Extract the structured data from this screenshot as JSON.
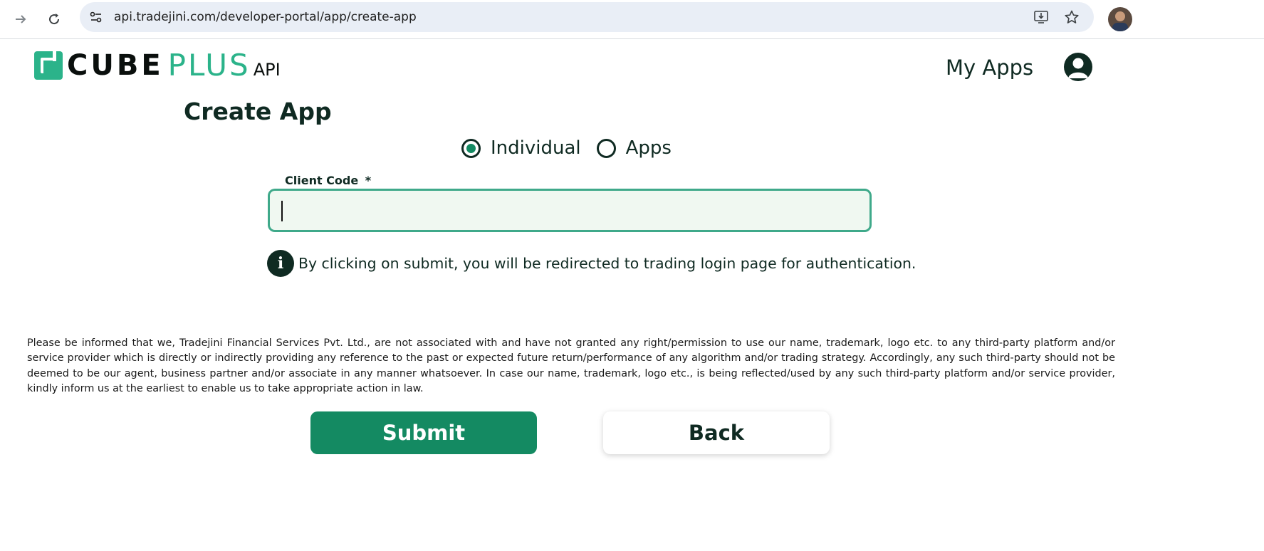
{
  "browser": {
    "url": "api.tradejini.com/developer-portal/app/create-app"
  },
  "header": {
    "logo": {
      "cube": "CUBE",
      "plus": "PLUS",
      "api": "API"
    },
    "nav_my_apps": "My Apps"
  },
  "page": {
    "title": "Create App",
    "radio_options": [
      {
        "label": "Individual",
        "selected": true
      },
      {
        "label": "Apps",
        "selected": false
      }
    ],
    "client_code": {
      "label": "Client Code",
      "required_mark": "*",
      "value": ""
    },
    "info_note": "By clicking on submit, you will be redirected to trading login page for authentication.",
    "info_icon": "i",
    "disclaimer": "Please be informed that we, Tradejini Financial Services Pvt. Ltd., are not associated with and have not granted any right/permission to use our name, trademark, logo etc. to any third-party platform and/or service provider which is directly or indirectly providing any reference to the past or expected future return/performance of any algorithm and/or trading strategy. Accordingly, any such third-party should not be deemed to be our agent, business partner and/or associate in any manner whatsoever. In case our name, trademark, logo etc., is being reflected/used by any such third-party platform and/or service provider, kindly inform us at the earliest to enable us to take appropriate action in law.",
    "buttons": {
      "submit": "Submit",
      "back": "Back"
    }
  },
  "colors": {
    "brand_green": "#148a62",
    "logo_green": "#2bb38a",
    "field_border": "#3fa98a",
    "field_bg": "#f0f8f1",
    "text_dark": "#0f2a22"
  }
}
